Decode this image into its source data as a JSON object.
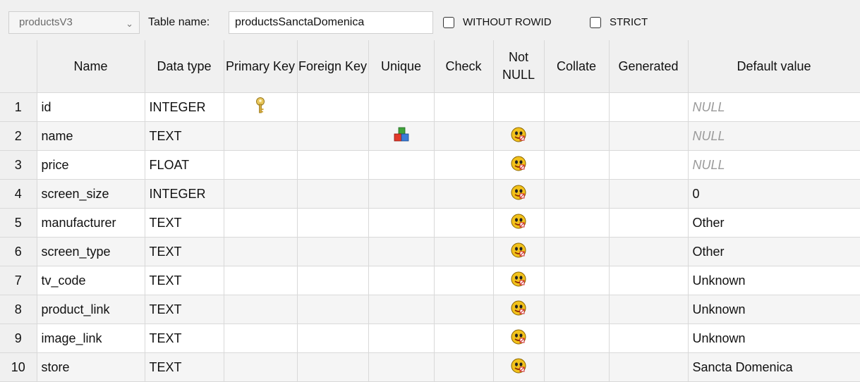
{
  "toolbar": {
    "schema": "productsV3",
    "table_name_label": "Table name:",
    "table_name_value": "productsSanctaDomenica",
    "without_rowid_label": "WITHOUT ROWID",
    "without_rowid_checked": false,
    "strict_label": "STRICT",
    "strict_checked": false
  },
  "columns": {
    "name": "Name",
    "data_type": "Data type",
    "primary_key": "Primary Key",
    "foreign_key": "Foreign Key",
    "unique": "Unique",
    "check": "Check",
    "not_null": "Not NULL",
    "collate": "Collate",
    "generated": "Generated",
    "default_value": "Default value"
  },
  "rows": [
    {
      "num": "1",
      "name": "id",
      "type": "INTEGER",
      "pk": true,
      "unique": false,
      "notnull": false,
      "default": "NULL",
      "default_is_null": true
    },
    {
      "num": "2",
      "name": "name",
      "type": "TEXT",
      "pk": false,
      "unique": true,
      "notnull": true,
      "default": "NULL",
      "default_is_null": true
    },
    {
      "num": "3",
      "name": "price",
      "type": "FLOAT",
      "pk": false,
      "unique": false,
      "notnull": true,
      "default": "NULL",
      "default_is_null": true
    },
    {
      "num": "4",
      "name": "screen_size",
      "type": "INTEGER",
      "pk": false,
      "unique": false,
      "notnull": true,
      "default": "0",
      "default_is_null": false
    },
    {
      "num": "5",
      "name": "manufacturer",
      "type": "TEXT",
      "pk": false,
      "unique": false,
      "notnull": true,
      "default": "Other",
      "default_is_null": false
    },
    {
      "num": "6",
      "name": "screen_type",
      "type": "TEXT",
      "pk": false,
      "unique": false,
      "notnull": true,
      "default": "Other",
      "default_is_null": false
    },
    {
      "num": "7",
      "name": "tv_code",
      "type": "TEXT",
      "pk": false,
      "unique": false,
      "notnull": true,
      "default": "Unknown",
      "default_is_null": false
    },
    {
      "num": "8",
      "name": "product_link",
      "type": "TEXT",
      "pk": false,
      "unique": false,
      "notnull": true,
      "default": "Unknown",
      "default_is_null": false
    },
    {
      "num": "9",
      "name": "image_link",
      "type": "TEXT",
      "pk": false,
      "unique": false,
      "notnull": true,
      "default": "Unknown",
      "default_is_null": false
    },
    {
      "num": "10",
      "name": "store",
      "type": "TEXT",
      "pk": false,
      "unique": false,
      "notnull": true,
      "default": "Sancta Domenica",
      "default_is_null": false
    }
  ],
  "icons": {
    "primary_key": "key-icon",
    "unique": "unique-blocks-icon",
    "not_null": "not-null-icon"
  }
}
